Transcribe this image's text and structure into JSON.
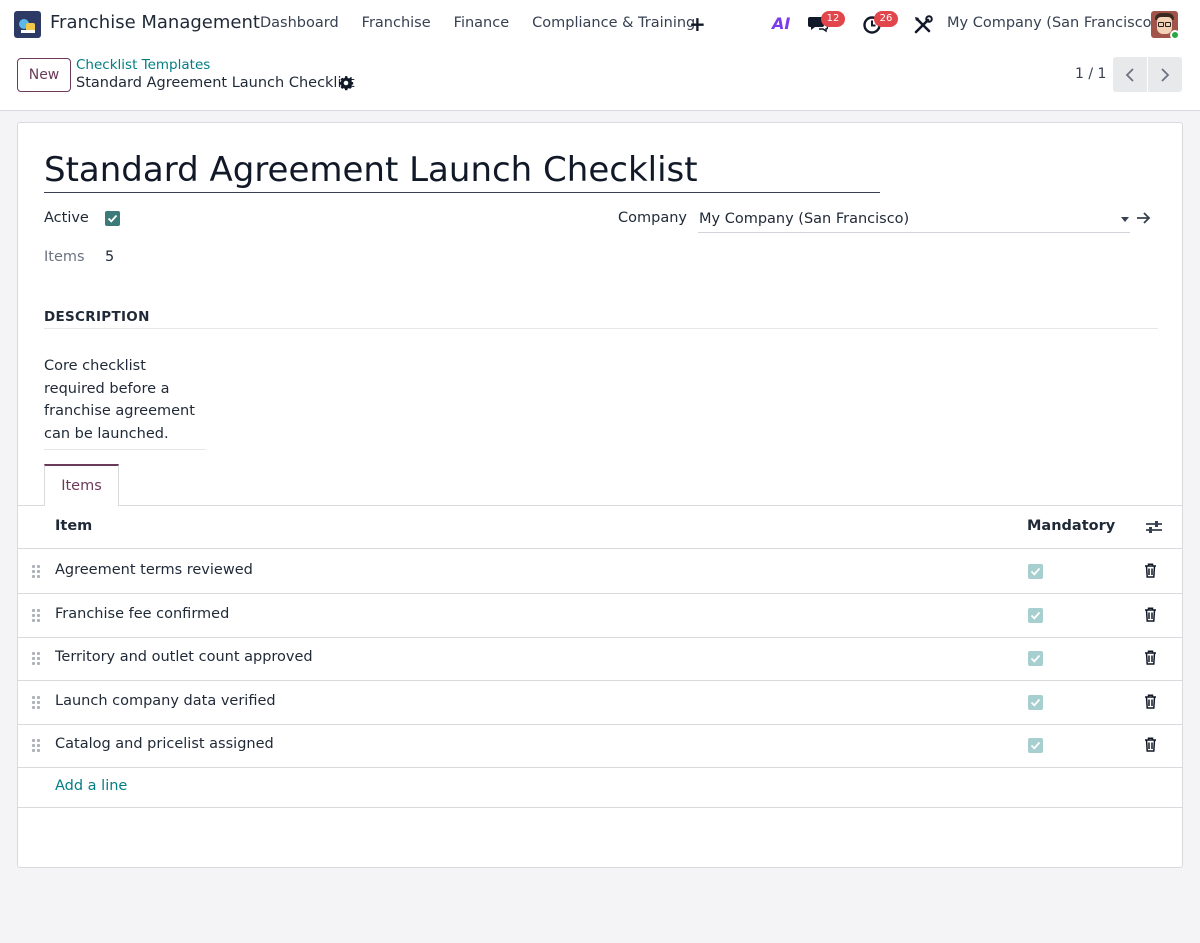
{
  "navbar": {
    "app_title": "Franchise Management",
    "menu": [
      "Dashboard",
      "Franchise",
      "Finance",
      "Compliance & Training"
    ],
    "plus_label": "+",
    "ai_label": "AI",
    "messages_count": "12",
    "activities_count": "26",
    "company": "My Company (San Francisco)"
  },
  "control_panel": {
    "new_label": "New",
    "breadcrumb_parent": "Checklist Templates",
    "breadcrumb_current": "Standard Agreement Launch Checklist",
    "pager_value": "1 / 1"
  },
  "form": {
    "title": "Standard Agreement Launch Checklist",
    "active_label": "Active",
    "active": true,
    "items_label": "Items",
    "items_count": "5",
    "company_label": "Company",
    "company_value": "My Company (San Francisco)",
    "description_heading": "DESCRIPTION",
    "description": "Core checklist required before a franchise agreement can be launched."
  },
  "tabs": [
    {
      "label": "Items",
      "active": true
    }
  ],
  "items_table": {
    "columns": [
      "Item",
      "Mandatory"
    ],
    "rows": [
      {
        "item": "Agreement terms reviewed",
        "mandatory": true
      },
      {
        "item": "Franchise fee confirmed",
        "mandatory": true
      },
      {
        "item": "Territory and outlet count approved",
        "mandatory": true
      },
      {
        "item": "Launch company data verified",
        "mandatory": true
      },
      {
        "item": "Catalog and pricelist assigned",
        "mandatory": true
      }
    ],
    "add_line_label": "Add a line"
  },
  "colors": {
    "accent": "#6b3a5a",
    "link": "#017e84",
    "checkbox": "#3c7a7a",
    "badge": "#e0464b"
  },
  "icons": [
    "app-icon",
    "chat-icon",
    "activity-clock-icon",
    "tools-icon",
    "gear-icon",
    "chevron-left-icon",
    "chevron-right-icon",
    "caret-down-icon",
    "external-arrow-icon",
    "optional-columns-icon",
    "drag-handle-icon",
    "trash-icon",
    "check-icon"
  ]
}
